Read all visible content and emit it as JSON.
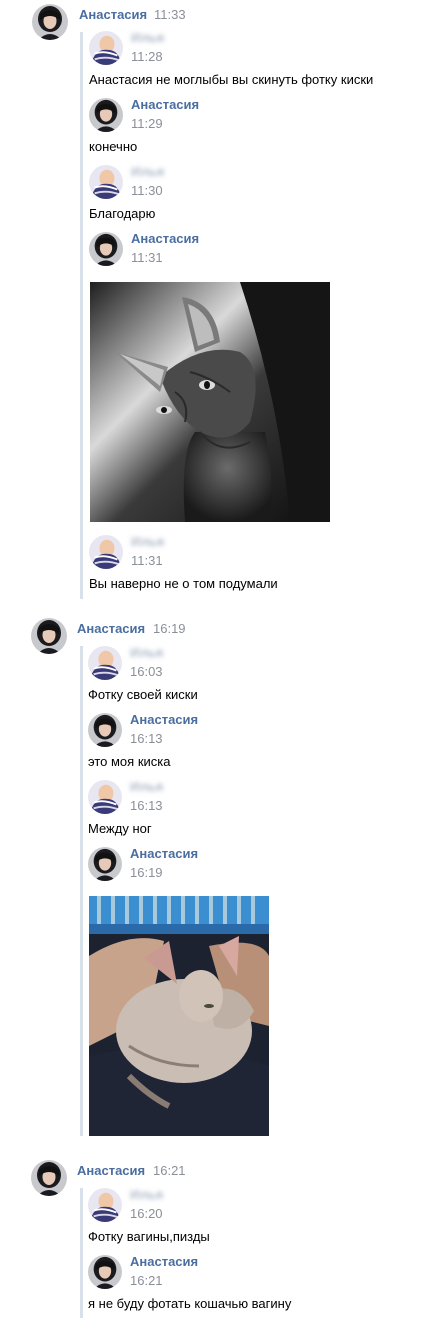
{
  "threads": [
    {
      "sender": "Анастасия",
      "time": "11:33",
      "items": [
        {
          "name": "Илья",
          "time": "11:28",
          "text": "Анастасия не моглыбы вы скинуть фотку киски"
        },
        {
          "name": "Анастасия",
          "time": "11:29",
          "text": "конечно"
        },
        {
          "name": "Илья",
          "time": "11:30",
          "text": "Благодарю"
        },
        {
          "name": "Анастасия",
          "time": "11:31",
          "text": ""
        },
        {
          "name": "Илья",
          "time": "11:31",
          "text": "Вы наверно не о том подумали"
        }
      ]
    },
    {
      "sender": "Анастасия",
      "time": "16:19",
      "items": [
        {
          "name": "Илья",
          "time": "16:03",
          "text": "Фотку своей киски"
        },
        {
          "name": "Анастасия",
          "time": "16:13",
          "text": "это моя киска"
        },
        {
          "name": "Илья",
          "time": "16:13",
          "text": "Между ног"
        },
        {
          "name": "Анастасия",
          "time": "16:19",
          "text": ""
        }
      ]
    },
    {
      "sender": "Анастасия",
      "time": "16:21",
      "items": [
        {
          "name": "Илья",
          "time": "16:20",
          "text": "Фотку вагины,пизды"
        },
        {
          "name": "Анастасия",
          "time": "16:21",
          "text": "я не буду фотать кошачью вагину"
        }
      ]
    }
  ],
  "colors": {
    "name": "#4a6ea0",
    "time": "#8a8f99",
    "forward_bar": "#d8e0ea"
  },
  "icons": {
    "avatar_woman": "avatar-woman-icon",
    "avatar_man": "avatar-man-icon"
  }
}
